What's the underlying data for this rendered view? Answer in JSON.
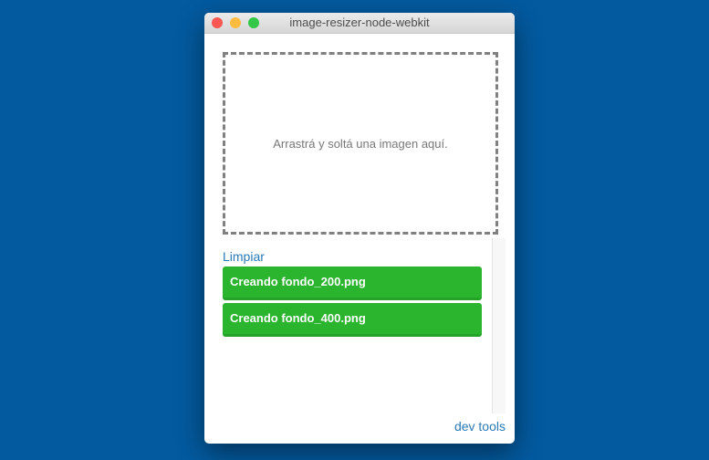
{
  "window": {
    "title": "image-resizer-node-webkit"
  },
  "dropzone": {
    "text": "Arrastrá y soltá una imagen aquí."
  },
  "clear_label": "Limpiar",
  "items": [
    {
      "label": "Creando fondo_200.png"
    },
    {
      "label": "Creando fondo_400.png"
    }
  ],
  "devtools_label": "dev tools",
  "colors": {
    "background": "#035a9f",
    "success": "#2bb52f",
    "link": "#2a7ab8"
  }
}
